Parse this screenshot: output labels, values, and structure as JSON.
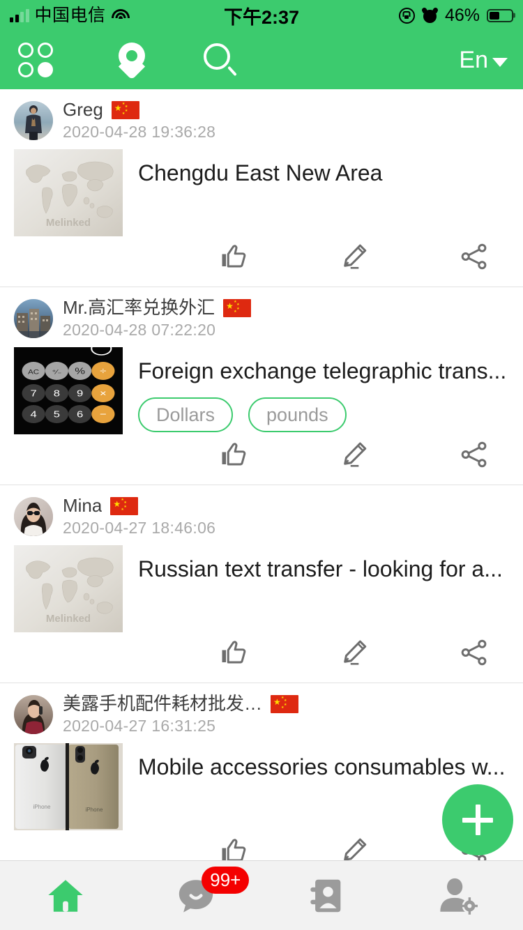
{
  "status_bar": {
    "carrier": "中国电信",
    "time": "下午2:37",
    "battery_percent": "46%",
    "battery_level": 46,
    "icons": [
      "signal-icon",
      "wifi-icon",
      "rotation-lock-icon",
      "alarm-icon",
      "battery-icon"
    ]
  },
  "header": {
    "grid_label": "grid-icon",
    "location_label": "location-pin-icon",
    "search_label": "search-icon",
    "language": "En",
    "bg_color": "#3ccb6e"
  },
  "feed": {
    "posts": [
      {
        "username": "Greg",
        "flag": "cn",
        "timestamp": "2020-04-28 19:36:28",
        "title": "Chengdu East New Area",
        "thumb": "world-map",
        "thumb_watermark": "Melinked",
        "tags": [],
        "actions": [
          "like-icon",
          "edit-icon",
          "share-icon"
        ]
      },
      {
        "username": "Mr.高汇率兑换外汇",
        "flag": "cn",
        "timestamp": "2020-04-28 07:22:20",
        "title": "Foreign exchange telegraphic trans...",
        "thumb": "calculator",
        "thumb_watermark": "",
        "tags": [
          "Dollars",
          "pounds"
        ],
        "actions": [
          "like-icon",
          "edit-icon",
          "share-icon"
        ]
      },
      {
        "username": "Mina",
        "flag": "cn",
        "timestamp": "2020-04-27 18:46:06",
        "title": "Russian text transfer - looking for a...",
        "thumb": "world-map",
        "thumb_watermark": "Melinked",
        "tags": [],
        "actions": [
          "like-icon",
          "edit-icon",
          "share-icon"
        ]
      },
      {
        "username": "美露手机配件耗材批发…",
        "flag": "cn",
        "timestamp": "2020-04-27 16:31:25",
        "title": "Mobile accessories consumables w...",
        "thumb": "phones",
        "thumb_watermark": "",
        "tags": [],
        "actions": [
          "like-icon",
          "edit-icon",
          "share-icon"
        ]
      }
    ]
  },
  "fab": {
    "label": "plus-icon",
    "color": "#3ccb6e"
  },
  "bottom_nav": {
    "items": [
      {
        "name": "home",
        "icon": "home-icon",
        "active": true,
        "badge": ""
      },
      {
        "name": "messages",
        "icon": "chat-bubble-icon",
        "active": false,
        "badge": "99+"
      },
      {
        "name": "contacts",
        "icon": "contact-card-icon",
        "active": false,
        "badge": ""
      },
      {
        "name": "profile",
        "icon": "user-settings-icon",
        "active": false,
        "badge": ""
      }
    ],
    "active_color": "#3ccb6e",
    "inactive_color": "#9b9b9b",
    "badge_color": "#f40000"
  },
  "calculator_thumb": {
    "rows": [
      [
        "AC",
        "⁺⁄₋",
        "%",
        "÷"
      ],
      [
        "7",
        "8",
        "9",
        "×"
      ],
      [
        "4",
        "5",
        "6",
        "−"
      ]
    ]
  }
}
